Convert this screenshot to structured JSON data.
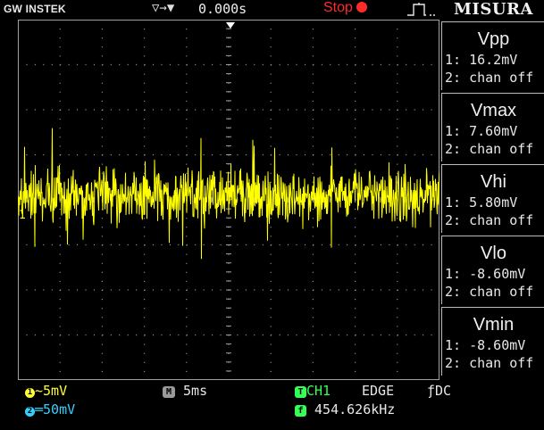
{
  "topbar": {
    "brand": "GW INSTEK",
    "trigger_arrows": "▽→▼",
    "horizontal_position": "0.000s",
    "run_state": "Stop",
    "misura": "MISURA"
  },
  "measurements": [
    {
      "title": "Vpp",
      "ch1": "1: 16.2mV",
      "ch2": "2: chan off"
    },
    {
      "title": "Vmax",
      "ch1": "1: 7.60mV",
      "ch2": "2: chan off"
    },
    {
      "title": "Vhi",
      "ch1": "1: 5.80mV",
      "ch2": "2: chan off"
    },
    {
      "title": "Vlo",
      "ch1": "1: -8.60mV",
      "ch2": "2: chan off"
    },
    {
      "title": "Vmin",
      "ch1": "1: -8.60mV",
      "ch2": "2: chan off"
    }
  ],
  "channel_marker": "1",
  "status": {
    "ch1_scale": "~5mV",
    "ch2_scale": "═50mV",
    "timebase": "5ms",
    "trigger_source": "CH1",
    "trigger_type": "EDGE",
    "trigger_coupling": "DC",
    "frequency": "454.626kHz"
  },
  "colors": {
    "ch1": "#ffff00",
    "ch2": "#33d0ff",
    "trigger": "#33ff55",
    "stop": "#ff2a2a",
    "grid": "#a0a0a0"
  }
}
